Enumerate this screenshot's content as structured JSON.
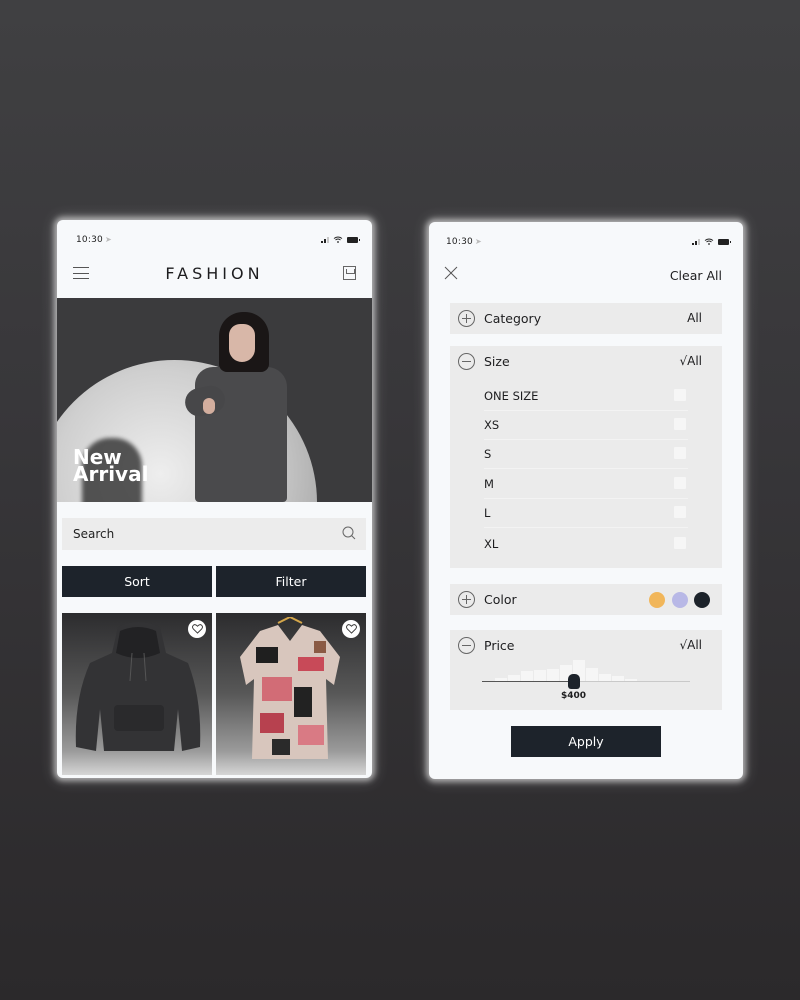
{
  "left_screen": {
    "status_bar": {
      "time": "10:30"
    },
    "header": {
      "brand": "FASHION",
      "menu_icon": "hamburger-menu-icon",
      "bag_icon": "shopping-bag-icon"
    },
    "hero": {
      "title_line1": "New",
      "title_line2": "Arrival"
    },
    "search": {
      "placeholder": "Search",
      "icon": "search-icon"
    },
    "actions": {
      "sort_label": "Sort",
      "filter_label": "Filter"
    },
    "products": [
      {
        "name": "Black hoodie",
        "favorite_icon": "heart-icon"
      },
      {
        "name": "Printed shirt",
        "favorite_icon": "heart-icon"
      }
    ]
  },
  "right_screen": {
    "status_bar": {
      "time": "10:30"
    },
    "header": {
      "close_icon": "close-icon",
      "clear_all_label": "Clear All"
    },
    "filters": {
      "category": {
        "label": "Category",
        "value": "All",
        "expanded": false
      },
      "size": {
        "label": "Size",
        "value": "√All",
        "expanded": true,
        "options": [
          {
            "label": "ONE SIZE",
            "checked": false
          },
          {
            "label": "XS",
            "checked": false
          },
          {
            "label": "S",
            "checked": false
          },
          {
            "label": "M",
            "checked": false
          },
          {
            "label": "L",
            "checked": false
          },
          {
            "label": "XL",
            "checked": false
          }
        ]
      },
      "color": {
        "label": "Color",
        "expanded": false,
        "swatches": [
          {
            "name": "yellow",
            "hex": "#f1b65a"
          },
          {
            "name": "lavender",
            "hex": "#b8b8e6"
          },
          {
            "name": "black",
            "hex": "#1d232b"
          }
        ]
      },
      "price": {
        "label": "Price",
        "value": "√All",
        "expanded": true,
        "selected_price": "$400",
        "slider_fraction": 0.44,
        "histogram_relative_heights": [
          0.05,
          0.15,
          0.3,
          0.45,
          0.5,
          0.55,
          0.7,
          0.9,
          0.6,
          0.35,
          0.25,
          0.12,
          0.06
        ]
      }
    },
    "apply_label": "Apply"
  }
}
